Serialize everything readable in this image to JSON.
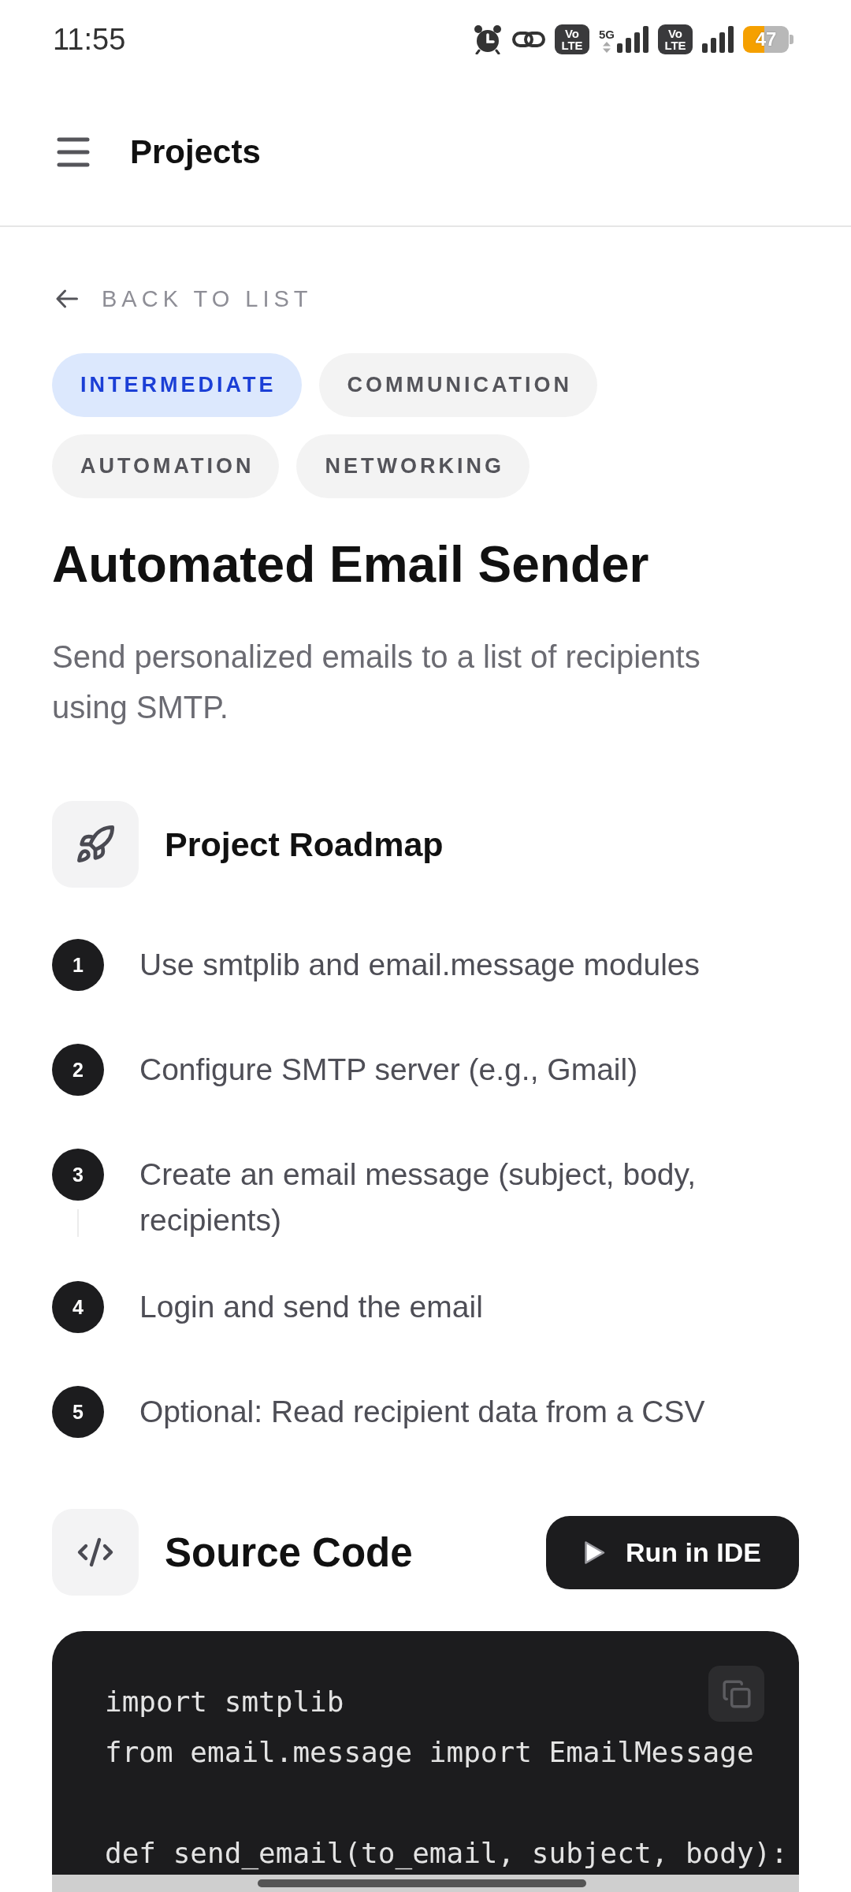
{
  "status_bar": {
    "time": "11:55",
    "indicators": [
      {
        "kind": "alarm"
      },
      {
        "kind": "link"
      },
      {
        "kind": "volte",
        "label": [
          "Vo",
          "LTE"
        ]
      },
      {
        "kind": "signal",
        "network": "5G"
      },
      {
        "kind": "volte",
        "label": [
          "Vo",
          "LTE"
        ]
      },
      {
        "kind": "signal"
      }
    ],
    "battery": {
      "text": "47"
    }
  },
  "app_bar": {
    "title": "Projects"
  },
  "back_link": {
    "label": "BACK TO LIST"
  },
  "tags": [
    {
      "label": "INTERMEDIATE",
      "kind": "difficulty"
    },
    {
      "label": "COMMUNICATION",
      "kind": "category"
    },
    {
      "label": "AUTOMATION",
      "kind": "category"
    },
    {
      "label": "NETWORKING",
      "kind": "category"
    }
  ],
  "project": {
    "title": "Automated Email Sender",
    "description": "Send personalized emails to a list of recipients using SMTP."
  },
  "roadmap": {
    "heading": "Project Roadmap",
    "steps": [
      {
        "number": "1",
        "text": "Use smtplib and email.message modules"
      },
      {
        "number": "2",
        "text": "Configure SMTP server (e.g., Gmail)"
      },
      {
        "number": "3",
        "text": "Create an email message (subject, body, recipients)"
      },
      {
        "number": "4",
        "text": "Login and send the email"
      },
      {
        "number": "5",
        "text": "Optional: Read recipient data from a CSV"
      }
    ]
  },
  "source_code": {
    "heading": "Source Code",
    "run_button": "Run in IDE",
    "code": "import smtplib\nfrom email.message import EmailMessage\n\ndef send_email(to_email, subject, body):"
  }
}
